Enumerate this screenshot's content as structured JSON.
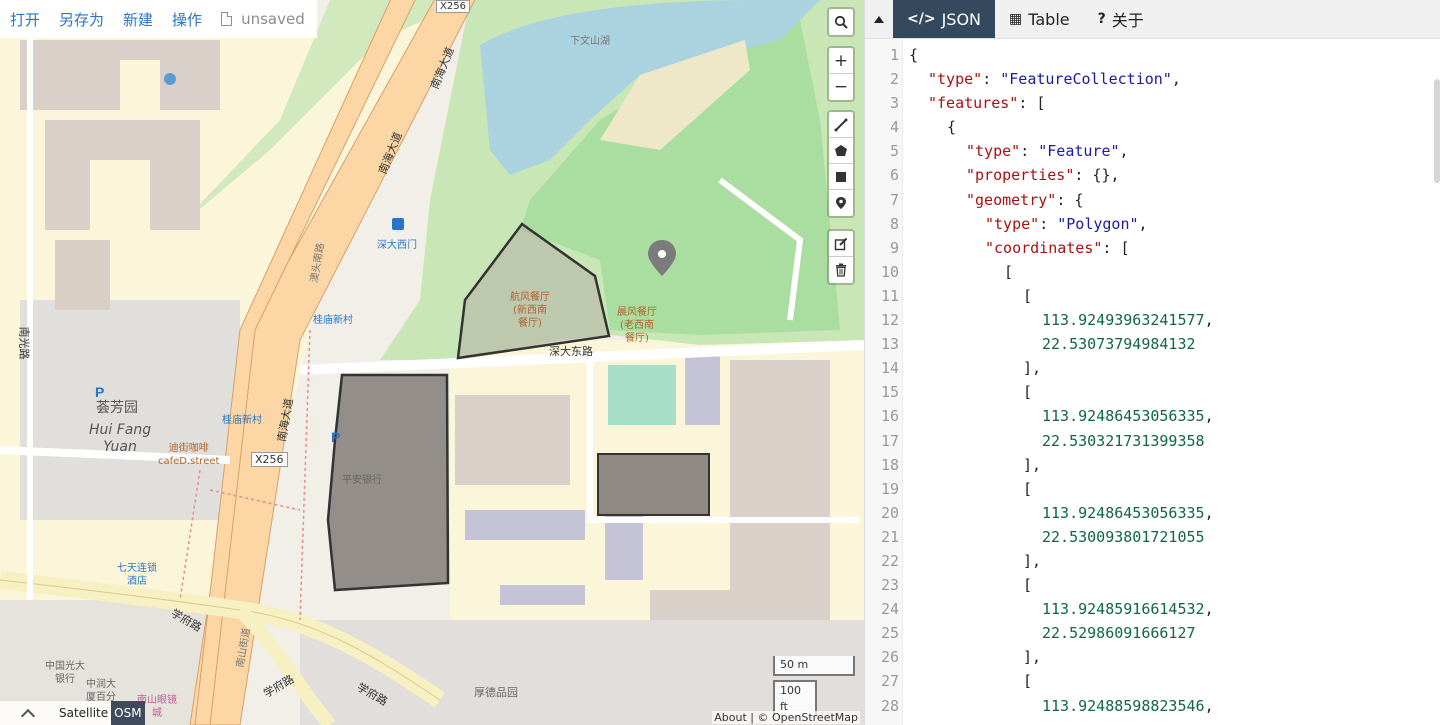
{
  "menu": {
    "open": "打开",
    "save_as": "另存为",
    "new": "新建",
    "operations": "操作",
    "file_status": "unsaved"
  },
  "map": {
    "labels": {
      "lake": "下文山湖",
      "road_nanhai_1": "南海大道",
      "road_nanhai_2": "南海大道",
      "road_nanhai_3": "南海大道",
      "road_x256_top": "X256",
      "road_x256": "X256",
      "road_shenda_east": "深大东路",
      "road_nanguang": "南光路",
      "road_xuefu_1": "学府路",
      "road_xuefu_2": "学府路",
      "road_xuefu_3": "学府路",
      "road_nanshan": "南山街道",
      "road_huitou": "澳头南路",
      "bus_shenda_west": "深大西门",
      "bus_guimiao_1": "桂庙新村",
      "bus_guimiao_2": "桂庙新村",
      "poi_hangfeng": "航风餐厅\n(新西南\n餐厅)",
      "poi_chenfeng": "晨风餐厅\n(老西南\n餐厅)",
      "poi_huifang_cn": "荟芳园",
      "poi_huifang_en": "Hui Fang\nYuan",
      "poi_cafe": "迪街咖啡\ncafeD.street",
      "poi_pingan": "平安银行",
      "poi_qitian": "七天连锁\n酒店",
      "poi_guangda": "中国光大\n银行",
      "poi_huarun": "中润大\n厦百分",
      "poi_nanshan_glasses": "南山眼镜\n城",
      "poi_houde": "厚德品园"
    },
    "controls": {
      "search_icon": "search-icon",
      "zoom_in": "+",
      "zoom_out": "−"
    },
    "scale": {
      "metric": "50 m",
      "imperial": "100 ft"
    },
    "attribution": "About | © OpenStreetMap",
    "layers": {
      "satellite": "Satellite",
      "osm": "OSM",
      "active": "OSM"
    },
    "colors": {
      "polygon_fill": "#7a7672",
      "polygon_stroke": "#333333",
      "marker": "#7b7b7b",
      "park": "#c8e6b6",
      "water": "#aad3df",
      "road_primary": "#fcd6a4"
    }
  },
  "pane": {
    "tabs": [
      {
        "label": "JSON",
        "icon": "</>",
        "active": true
      },
      {
        "label": "Table",
        "icon": "▦",
        "active": false
      },
      {
        "label": "关于",
        "icon": "?",
        "active": false
      }
    ]
  },
  "code_lines": [
    {
      "n": 1,
      "i": 0,
      "t": [
        [
          "p",
          "{"
        ]
      ]
    },
    {
      "n": 2,
      "i": 1,
      "t": [
        [
          "k",
          "\"type\""
        ],
        [
          "p",
          ": "
        ],
        [
          "s",
          "\"FeatureCollection\""
        ],
        [
          "p",
          ","
        ]
      ]
    },
    {
      "n": 3,
      "i": 1,
      "t": [
        [
          "k",
          "\"features\""
        ],
        [
          "p",
          ": ["
        ]
      ]
    },
    {
      "n": 4,
      "i": 2,
      "t": [
        [
          "p",
          "{"
        ]
      ]
    },
    {
      "n": 5,
      "i": 3,
      "t": [
        [
          "k",
          "\"type\""
        ],
        [
          "p",
          ": "
        ],
        [
          "s",
          "\"Feature\""
        ],
        [
          "p",
          ","
        ]
      ]
    },
    {
      "n": 6,
      "i": 3,
      "t": [
        [
          "k",
          "\"properties\""
        ],
        [
          "p",
          ": {},"
        ]
      ]
    },
    {
      "n": 7,
      "i": 3,
      "t": [
        [
          "k",
          "\"geometry\""
        ],
        [
          "p",
          ": {"
        ]
      ]
    },
    {
      "n": 8,
      "i": 4,
      "t": [
        [
          "k",
          "\"type\""
        ],
        [
          "p",
          ": "
        ],
        [
          "s",
          "\"Polygon\""
        ],
        [
          "p",
          ","
        ]
      ]
    },
    {
      "n": 9,
      "i": 4,
      "t": [
        [
          "k",
          "\"coordinates\""
        ],
        [
          "p",
          ": ["
        ]
      ]
    },
    {
      "n": 10,
      "i": 5,
      "t": [
        [
          "p",
          "["
        ]
      ]
    },
    {
      "n": 11,
      "i": 6,
      "t": [
        [
          "p",
          "["
        ]
      ]
    },
    {
      "n": 12,
      "i": 7,
      "t": [
        [
          "n",
          "113.92493963241577"
        ],
        [
          "p",
          ","
        ]
      ]
    },
    {
      "n": 13,
      "i": 7,
      "t": [
        [
          "n",
          "22.53073794984132"
        ]
      ]
    },
    {
      "n": 14,
      "i": 6,
      "t": [
        [
          "p",
          "],"
        ]
      ]
    },
    {
      "n": 15,
      "i": 6,
      "t": [
        [
          "p",
          "["
        ]
      ]
    },
    {
      "n": 16,
      "i": 7,
      "t": [
        [
          "n",
          "113.92486453056335"
        ],
        [
          "p",
          ","
        ]
      ]
    },
    {
      "n": 17,
      "i": 7,
      "t": [
        [
          "n",
          "22.530321731399358"
        ]
      ]
    },
    {
      "n": 18,
      "i": 6,
      "t": [
        [
          "p",
          "],"
        ]
      ]
    },
    {
      "n": 19,
      "i": 6,
      "t": [
        [
          "p",
          "["
        ]
      ]
    },
    {
      "n": 20,
      "i": 7,
      "t": [
        [
          "n",
          "113.92486453056335"
        ],
        [
          "p",
          ","
        ]
      ]
    },
    {
      "n": 21,
      "i": 7,
      "t": [
        [
          "n",
          "22.530093801721055"
        ]
      ]
    },
    {
      "n": 22,
      "i": 6,
      "t": [
        [
          "p",
          "],"
        ]
      ]
    },
    {
      "n": 23,
      "i": 6,
      "t": [
        [
          "p",
          "["
        ]
      ]
    },
    {
      "n": 24,
      "i": 7,
      "t": [
        [
          "n",
          "113.92485916614532"
        ],
        [
          "p",
          ","
        ]
      ]
    },
    {
      "n": 25,
      "i": 7,
      "t": [
        [
          "n",
          "22.52986091666127"
        ]
      ]
    },
    {
      "n": 26,
      "i": 6,
      "t": [
        [
          "p",
          "],"
        ]
      ]
    },
    {
      "n": 27,
      "i": 6,
      "t": [
        [
          "p",
          "["
        ]
      ]
    },
    {
      "n": 28,
      "i": 7,
      "t": [
        [
          "n",
          "113.92488598823546"
        ],
        [
          "p",
          ","
        ]
      ]
    }
  ]
}
